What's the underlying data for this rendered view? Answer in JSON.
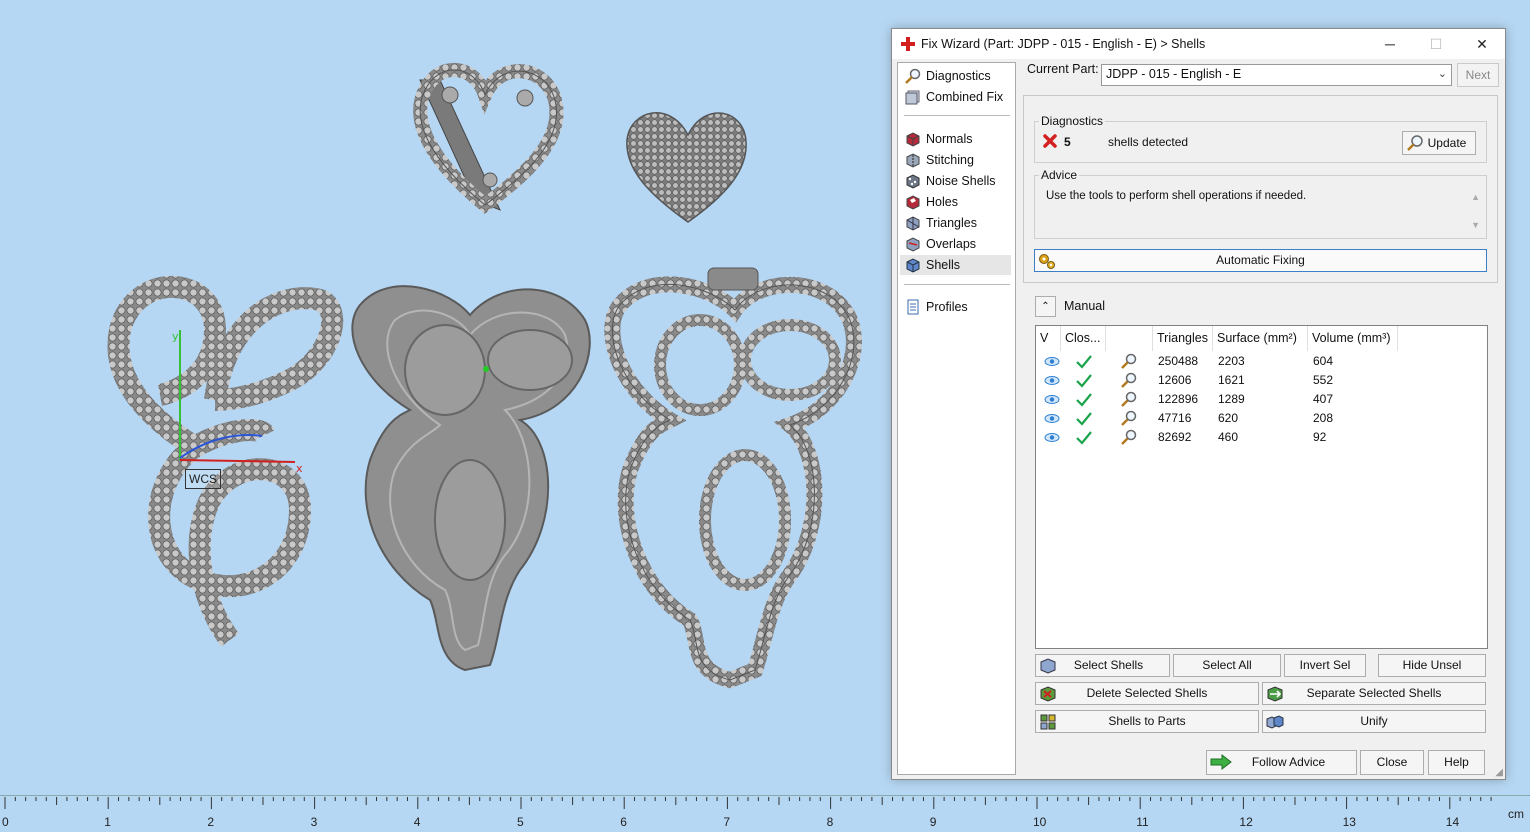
{
  "viewport": {
    "wcs_label": "WCS",
    "axis_x": "x",
    "axis_y": "y"
  },
  "ruler": {
    "unit": "cm",
    "labels": [
      "0",
      "1",
      "2",
      "3",
      "4",
      "5",
      "6",
      "7",
      "8",
      "9",
      "10",
      "11",
      "12",
      "13",
      "14"
    ]
  },
  "window": {
    "title": "Fix Wizard (Part: JDPP - 015 - English - E) > Shells",
    "controls": {
      "minimize": "─",
      "maximize": "☐",
      "close": "✕"
    }
  },
  "nav": {
    "items": [
      {
        "label": "Diagnostics",
        "icon": "magnifier-icon"
      },
      {
        "label": "Combined Fix",
        "icon": "combined-fix-icon"
      },
      {
        "label": "Normals",
        "icon": "normals-icon"
      },
      {
        "label": "Stitching",
        "icon": "stitching-icon"
      },
      {
        "label": "Noise Shells",
        "icon": "noise-shells-icon"
      },
      {
        "label": "Holes",
        "icon": "holes-icon"
      },
      {
        "label": "Triangles",
        "icon": "triangles-icon"
      },
      {
        "label": "Overlaps",
        "icon": "overlaps-icon"
      },
      {
        "label": "Shells",
        "icon": "shells-icon"
      },
      {
        "label": "Profiles",
        "icon": "profiles-icon"
      }
    ],
    "selected": "Shells"
  },
  "current_part": {
    "label": "Current Part:",
    "value": "JDPP - 015 - English - E",
    "next_label": "Next"
  },
  "diagnostics": {
    "group_label": "Diagnostics",
    "count": "5",
    "message": "shells detected",
    "update_label": "Update",
    "status_color": "#d32020"
  },
  "advice": {
    "group_label": "Advice",
    "text": "Use the tools to perform shell operations if needed."
  },
  "auto_fix": {
    "label": "Automatic Fixing"
  },
  "manual": {
    "label": "Manual",
    "columns": [
      "V",
      "Clos...",
      "",
      "Triangles",
      "Surface (mm²)",
      "Volume (mm³)"
    ],
    "rows": [
      {
        "triangles": "250488",
        "surface": "2203",
        "volume": "604"
      },
      {
        "triangles": "12606",
        "surface": "1621",
        "volume": "552"
      },
      {
        "triangles": "122896",
        "surface": "1289",
        "volume": "407"
      },
      {
        "triangles": "47716",
        "surface": "620",
        "volume": "208"
      },
      {
        "triangles": "82692",
        "surface": "460",
        "volume": "92"
      }
    ],
    "buttons": {
      "select_shells": "Select Shells",
      "select_all": "Select All",
      "invert_sel": "Invert Sel",
      "hide_unsel": "Hide Unsel",
      "delete_selected": "Delete Selected Shells",
      "separate_selected": "Separate Selected Shells",
      "shells_to_parts": "Shells to Parts",
      "unify": "Unify"
    }
  },
  "footer": {
    "follow_advice": "Follow Advice",
    "close": "Close",
    "help": "Help"
  },
  "colors": {
    "viewport_bg": "#b6d7f3",
    "model_gray": "#8e8e8e",
    "check_green": "#1aa34a",
    "eye_blue": "#2f7fd0"
  }
}
